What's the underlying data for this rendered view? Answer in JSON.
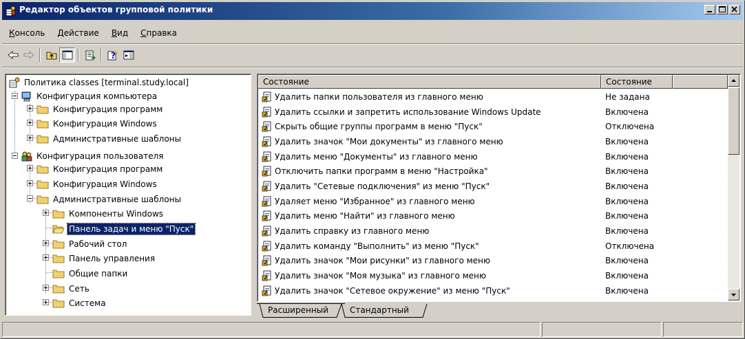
{
  "window": {
    "title": "Редактор объектов групповой политики"
  },
  "menu": [
    {
      "underline": "К",
      "rest": "онсоль"
    },
    {
      "underline": "Д",
      "rest": "ействие"
    },
    {
      "underline": "В",
      "rest": "ид"
    },
    {
      "underline": "С",
      "rest": "правка"
    }
  ],
  "tree": {
    "root": "Политика classes [terminal.study.local]",
    "computer_config": "Конфигурация компьютера",
    "cc_programs": "Конфигурация программ",
    "cc_windows": "Конфигурация Windows",
    "cc_templates": "Административные шаблоны",
    "user_config": "Конфигурация пользователя",
    "uc_programs": "Конфигурация программ",
    "uc_windows": "Конфигурация Windows",
    "uc_templates": "Административные шаблоны",
    "t_components": "Компоненты Windows",
    "t_taskbar": "Панель задач и меню \"Пуск\"",
    "t_desktop": "Рабочий стол",
    "t_control_panel": "Панель управления",
    "t_shared": "Общие папки",
    "t_network": "Сеть",
    "t_system": "Система"
  },
  "list": {
    "headers": [
      "Состояние",
      "Состояние",
      ""
    ],
    "rows": [
      {
        "name": "Удалить папки пользователя из главного меню",
        "state": "Не задана"
      },
      {
        "name": "Удалить ссылки и запретить использование Windows Update",
        "state": "Включена"
      },
      {
        "name": "Скрыть общие группы программ в меню \"Пуск\"",
        "state": "Отключена"
      },
      {
        "name": "Удалить значок \"Мои документы\" из главного меню",
        "state": "Включена"
      },
      {
        "name": "Удалить меню \"Документы\" из главного меню",
        "state": "Включена"
      },
      {
        "name": "Отключить папки программ в меню \"Настройка\"",
        "state": "Включена"
      },
      {
        "name": "Удалить \"Сетевые подключения\" из меню \"Пуск\"",
        "state": "Включена"
      },
      {
        "name": "Удаляет меню \"Избранное\" из главного меню",
        "state": "Включена"
      },
      {
        "name": "Удалить меню \"Найти\" из главного меню",
        "state": "Включена"
      },
      {
        "name": "Удалить справку из главного меню",
        "state": "Включена"
      },
      {
        "name": "Удалить команду \"Выполнить\" из меню \"Пуск\"",
        "state": "Отключена"
      },
      {
        "name": "Удалить значок \"Мои рисунки\" из главного меню",
        "state": "Включена"
      },
      {
        "name": "Удалить значок \"Моя музыка\" из главного меню",
        "state": "Включена"
      },
      {
        "name": "Удалить значок \"Сетевое окружение\" из меню \"Пуск\"",
        "state": "Включена"
      }
    ]
  },
  "tabs": {
    "extended": "Расширенный",
    "standard": "Стандартный"
  }
}
